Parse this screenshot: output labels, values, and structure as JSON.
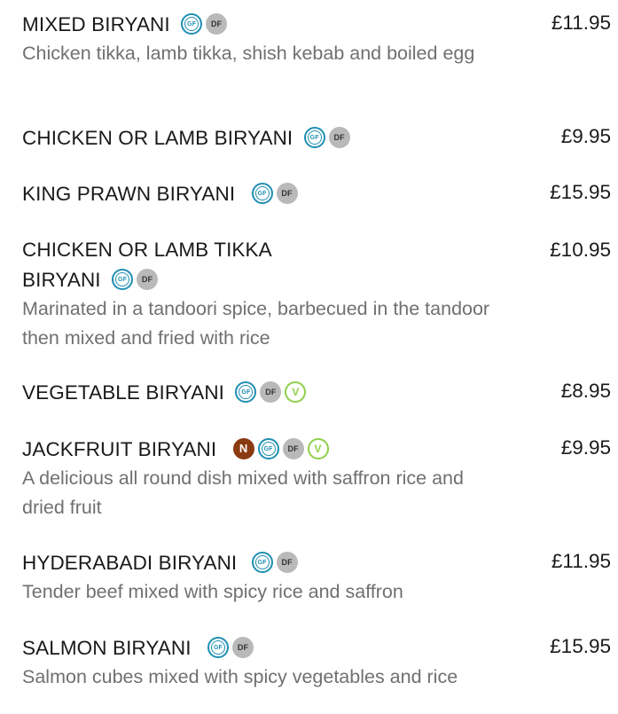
{
  "items": [
    {
      "name": "MIXED BIRYANI",
      "badges": [
        "GF",
        "DF"
      ],
      "price": "£11.95",
      "desc": "Chicken tikka, lamb tikka, shish kebab and boiled egg"
    },
    {
      "name": "CHICKEN OR LAMB BIRYANI",
      "badges": [
        "GF",
        "DF"
      ],
      "price": "£9.95",
      "desc": ""
    },
    {
      "name": "KING PRAWN BIRYANI",
      "badges": [
        "GF",
        "DF"
      ],
      "price": "£15.95",
      "desc": ""
    },
    {
      "name_line1": "CHICKEN OR LAMB TIKKA",
      "name_line2": "BIRYANI",
      "badges": [
        "GF",
        "DF"
      ],
      "price": "£10.95",
      "desc": "Marinated in a tandoori spice, barbecued in the tandoor then mixed and fried with rice"
    },
    {
      "name": "VEGETABLE BIRYANI",
      "badges": [
        "GF",
        "DF",
        "V"
      ],
      "price": "£8.95",
      "desc": ""
    },
    {
      "name": "JACKFRUIT BIRYANI",
      "badges": [
        "N",
        "GF",
        "DF",
        "V"
      ],
      "price": "£9.95",
      "desc": "A delicious all round dish mixed with saffron rice and dried fruit"
    },
    {
      "name": "HYDERABADI BIRYANI",
      "badges": [
        "GF",
        "DF"
      ],
      "price": "£11.95",
      "desc": "Tender beef mixed with spicy rice and saffron"
    },
    {
      "name": "SALMON BIRYANI",
      "badges": [
        "GF",
        "DF"
      ],
      "price": "£15.95",
      "desc": "Salmon cubes mixed with spicy vegetables and rice"
    }
  ],
  "badge_labels": {
    "gf": "GF",
    "df": "DF",
    "v": "V",
    "n": "N"
  },
  "colors": {
    "gf": "#1f8fb3",
    "df": "#b9b9b9",
    "v": "#8fcf4a",
    "n": "#8a3b12",
    "desc": "#707070"
  }
}
